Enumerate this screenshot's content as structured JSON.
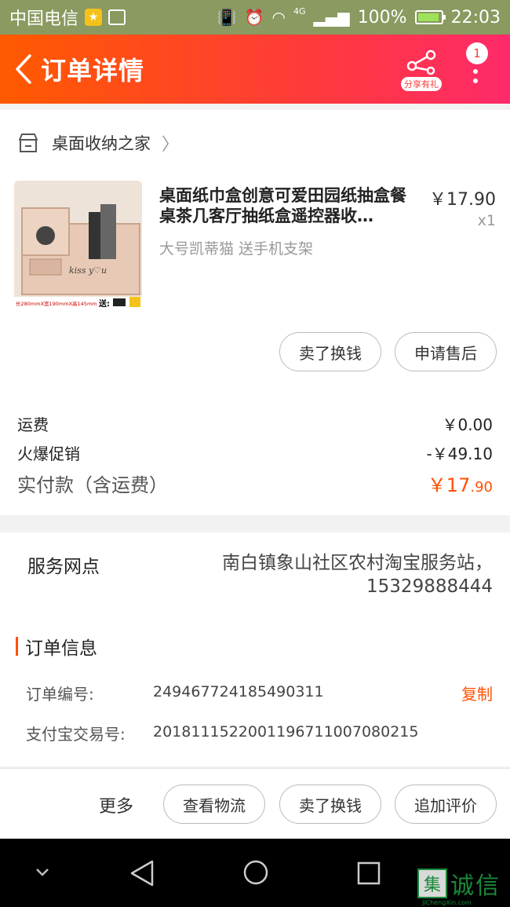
{
  "status_bar": {
    "carrier": "中国电信",
    "network": "4G",
    "battery": "100%",
    "time": "22:03"
  },
  "header": {
    "title": "订单详情",
    "share_label": "分享有礼",
    "notification_count": "1"
  },
  "store": {
    "name": "桌面收纳之家"
  },
  "product": {
    "title": "桌面纸巾盒创意可爱田园纸抽盒餐桌茶几客厅抽纸盒遥控器收…",
    "sku": "大号凯蒂猫 送手机支架",
    "price": "￥17.90",
    "quantity": "x1",
    "image_text": "kiss y♡u",
    "image_caption": "长280mmX宽190mmX高145mm",
    "image_gift": "送:"
  },
  "product_actions": {
    "sell_button": "卖了换钱",
    "after_sale_button": "申请售后"
  },
  "fees": {
    "shipping_label": "运费",
    "shipping_value": "￥0.00",
    "promo_label": "火爆促销",
    "promo_value": "-￥49.10",
    "total_label": "实付款（含运费）",
    "total_int": "￥17",
    "total_dec": ".90"
  },
  "service": {
    "label": "服务网点",
    "name": "南白镇象山社区农村淘宝服务站，",
    "phone": "15329888444"
  },
  "order_info": {
    "title": "订单信息",
    "order_no_label": "订单编号:",
    "order_no": "249467724185490311",
    "copy_label": "复制",
    "alipay_label": "支付宝交易号:",
    "alipay_no": "2018111522001196711007080215"
  },
  "bottom_actions": {
    "more_label": "更多",
    "logistics_button": "查看物流",
    "sell_button": "卖了换钱",
    "review_button": "追加评价"
  },
  "watermark": {
    "mark": "集",
    "text": "诚信",
    "url": "JiChengXin.com"
  },
  "colors": {
    "accent": "#ff5000",
    "header_start": "#ff5a00",
    "header_end": "#ff2a6a",
    "status_bar": "#8a9a60"
  }
}
